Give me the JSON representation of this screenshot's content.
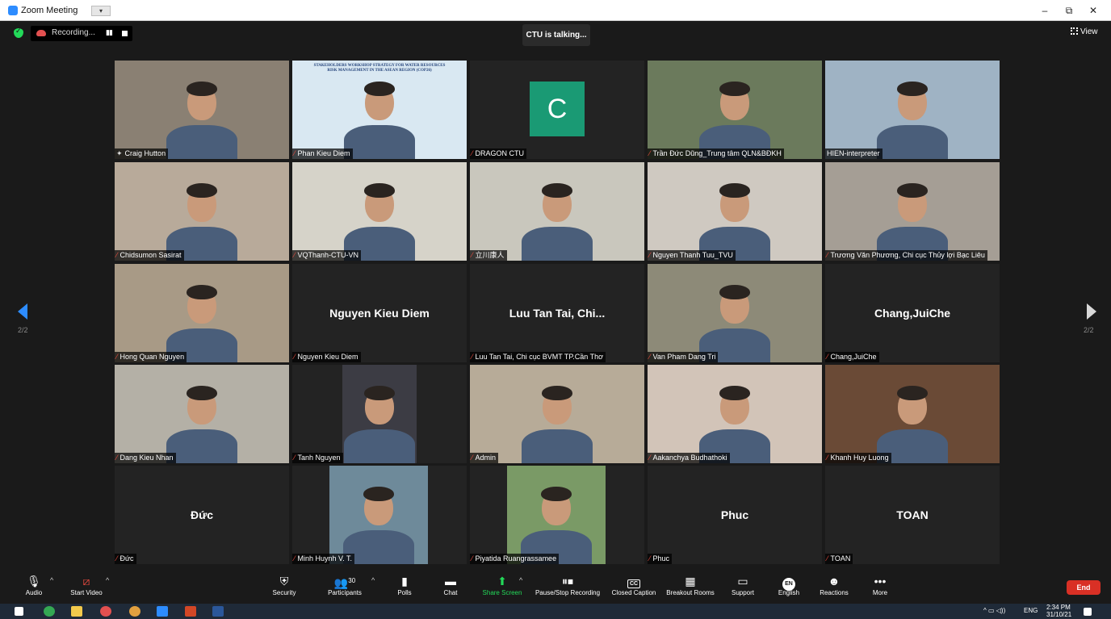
{
  "window": {
    "title": "Zoom Meeting",
    "dropdown": "▾",
    "minimize": "–",
    "restore": "⧉",
    "close": "✕"
  },
  "top": {
    "recording_label": "Recording...",
    "speaker_status": "CTU is talking...",
    "view_label": "View"
  },
  "pagination": {
    "left": "2/2",
    "right": "2/2"
  },
  "tiles": [
    {
      "name": "Craig Hutton",
      "icon": "pin-icon",
      "bg": "#8a8073"
    },
    {
      "name": "Phan Kieu Diem",
      "icon": "mic-muted-icon",
      "bg": "#d9e8f2",
      "banner": "STAKEHOLDERS WORKSHOP STRATEGY FOR WATER RESOURCES RISK MANAGEMENT IN THE ASEAN REGION (COP26)"
    },
    {
      "name": "DRAGON CTU",
      "icon": "mic-muted-icon",
      "avatar_letter": "C"
    },
    {
      "name": "Trần Đức Dũng_Trung tâm QLN&BĐKH",
      "icon": "mic-muted-icon",
      "bg": "#6b7a5c"
    },
    {
      "name": "HIEN-interpreter",
      "icon": "none",
      "bg": "#9fb3c4"
    },
    {
      "name": "Chidsumon Sasirat",
      "icon": "mic-muted-icon",
      "bg": "#b8aa9a"
    },
    {
      "name": "VQThanh-CTU-VN",
      "icon": "mic-muted-icon",
      "bg": "#d6d3c9"
    },
    {
      "name": "立川康人",
      "icon": "mic-muted-icon",
      "bg": "#c9c7bd"
    },
    {
      "name": "Nguyen Thanh Tuu_TVU",
      "icon": "mic-muted-icon",
      "bg": "#cfc9c1"
    },
    {
      "name": "Trương Văn Phương, Chi cục Thủy lợi Bạc Liêu",
      "icon": "mic-muted-icon",
      "bg": "#a59e95"
    },
    {
      "name": "Hong Quan Nguyen",
      "icon": "mic-muted-icon",
      "bg": "#a89a86"
    },
    {
      "name": "Nguyen Kieu Diem",
      "icon": "mic-muted-icon",
      "display": "Nguyen Kieu Diem"
    },
    {
      "name": "Luu Tan Tai, Chi cục BVMT TP.Cần Thơ",
      "icon": "mic-muted-icon",
      "display": "Luu Tan Tai, Chi..."
    },
    {
      "name": "Van Pham Dang Tri",
      "icon": "mic-muted-icon",
      "bg": "#8d8a78"
    },
    {
      "name": "Chang,JuiChe",
      "icon": "mic-muted-icon",
      "display": "Chang,JuiChe"
    },
    {
      "name": "Dang Kieu Nhan",
      "icon": "mic-muted-icon",
      "bg": "#b4b0a6"
    },
    {
      "name": "Tanh Nguyen",
      "icon": "mic-muted-icon",
      "bg": "#3c3c44"
    },
    {
      "name": "Admin",
      "icon": "mic-muted-icon",
      "bg": "#b7ab98"
    },
    {
      "name": "Aakanchya Budhathoki",
      "icon": "mic-muted-icon",
      "bg": "#d2c4b8"
    },
    {
      "name": "Khanh Huy Luong",
      "icon": "mic-muted-icon",
      "bg": "#6a4a36"
    },
    {
      "name": "Đức",
      "icon": "mic-muted-icon",
      "display": "Đức"
    },
    {
      "name": "Minh Huynh V. T.",
      "icon": "mic-muted-icon",
      "bg": "#6e8a9a"
    },
    {
      "name": "Piyatida Ruangrassamee",
      "icon": "mic-muted-icon",
      "bg": "#7a9a66"
    },
    {
      "name": "Phuc",
      "icon": "mic-muted-icon",
      "display": "Phuc"
    },
    {
      "name": "TOAN",
      "icon": "mic-muted-icon",
      "display": "TOAN"
    }
  ],
  "toolbar": {
    "audio": "Audio",
    "start_video": "Start Video",
    "security": "Security",
    "participants": "Participants",
    "participants_count": "30",
    "polls": "Polls",
    "chat": "Chat",
    "share_screen": "Share Screen",
    "pause_recording": "Pause/Stop Recording",
    "closed_caption": "Closed Caption",
    "cc_icon": "CC",
    "breakout_rooms": "Breakout Rooms",
    "support": "Support",
    "english": "English",
    "en_icon": "EN",
    "reactions": "Reactions",
    "more": "More",
    "end": "End"
  },
  "taskbar": {
    "lang": "ENG",
    "time": "2:34 PM",
    "date": "31/10/21"
  },
  "colors": {
    "accent": "#2d8cff",
    "end": "#d93025",
    "share": "#23d959",
    "muted": "#e84a3f"
  }
}
